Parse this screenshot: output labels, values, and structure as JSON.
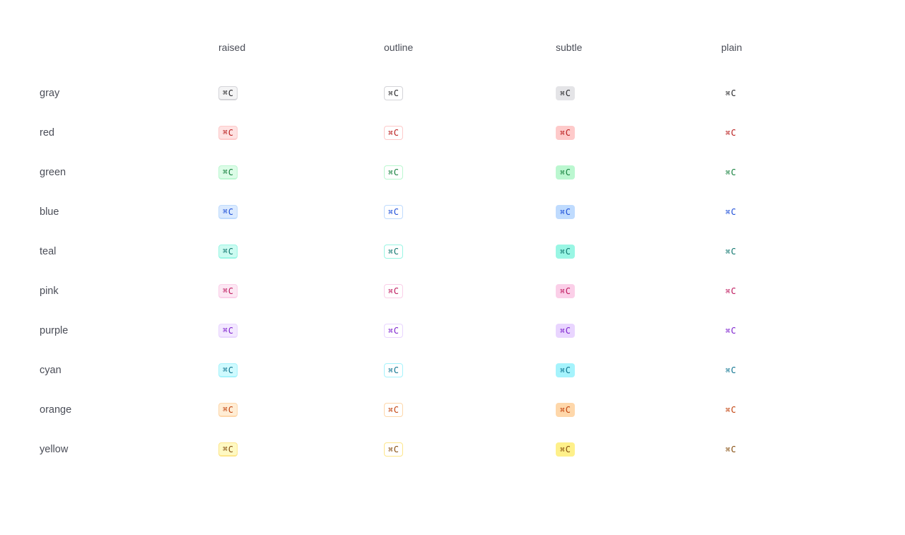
{
  "columns": [
    "raised",
    "outline",
    "subtle",
    "plain"
  ],
  "key_label": "⌘C",
  "key_modifier": "⌘",
  "key_char": "C",
  "rows": [
    {
      "label": "gray",
      "fg": "#27272a",
      "raised_bg": "#f4f4f5",
      "raised_border": "#d4d4d8",
      "outline_border": "#d4d4d8",
      "subtle_bg": "#e4e4e7"
    },
    {
      "label": "red",
      "fg": "#b91c1c",
      "raised_bg": "#fee2e2",
      "raised_border": "#fecaca",
      "outline_border": "#fecaca",
      "subtle_bg": "#fecaca"
    },
    {
      "label": "green",
      "fg": "#15803d",
      "raised_bg": "#dcfce7",
      "raised_border": "#bbf7d0",
      "outline_border": "#bbf7d0",
      "subtle_bg": "#bbf7d0"
    },
    {
      "label": "blue",
      "fg": "#1d4ed8",
      "raised_bg": "#dbeafe",
      "raised_border": "#bfdbfe",
      "outline_border": "#bfdbfe",
      "subtle_bg": "#bfdbfe"
    },
    {
      "label": "teal",
      "fg": "#0f766e",
      "raised_bg": "#ccfbf1",
      "raised_border": "#99f6e4",
      "outline_border": "#99f6e4",
      "subtle_bg": "#99f6e4"
    },
    {
      "label": "pink",
      "fg": "#be185d",
      "raised_bg": "#fce7f3",
      "raised_border": "#fbcfe8",
      "outline_border": "#fbcfe8",
      "subtle_bg": "#fbcfe8"
    },
    {
      "label": "purple",
      "fg": "#7e22ce",
      "raised_bg": "#f3e8ff",
      "raised_border": "#e9d5ff",
      "outline_border": "#e9d5ff",
      "subtle_bg": "#e9d5ff"
    },
    {
      "label": "cyan",
      "fg": "#0e7490",
      "raised_bg": "#cffafe",
      "raised_border": "#a5f3fc",
      "outline_border": "#a5f3fc",
      "subtle_bg": "#a5f3fc"
    },
    {
      "label": "orange",
      "fg": "#c2410c",
      "raised_bg": "#ffedd5",
      "raised_border": "#fed7aa",
      "outline_border": "#fed7aa",
      "subtle_bg": "#fed7aa"
    },
    {
      "label": "yellow",
      "fg": "#854d0e",
      "raised_bg": "#fef9c3",
      "raised_border": "#fde68a",
      "outline_border": "#fde68a",
      "subtle_bg": "#fef08a"
    }
  ]
}
